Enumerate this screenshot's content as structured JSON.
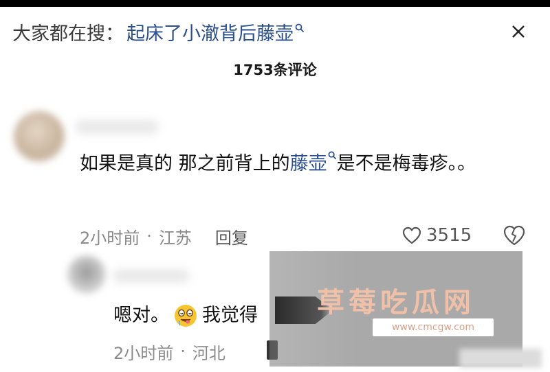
{
  "header": {
    "prefix": "大家都在搜：",
    "keyword": "起床了小澈背后藤壶",
    "search_icon": "search-icon",
    "close_icon": "close-icon"
  },
  "comments_count": "1753条评论",
  "comments": [
    {
      "text_before": "如果是真的 那之前背上的",
      "link_text": "藤壶",
      "text_after": "是不是梅毒疹。。",
      "time": "2小时前",
      "location": "江苏",
      "reply_label": "回复",
      "likes": "3515"
    },
    {
      "text_before": "嗯对。",
      "emoji": "drooling-face",
      "text_after": "我觉得",
      "time": "2小时前",
      "location": "河北"
    }
  ],
  "watermark": {
    "title": "草莓吃瓜网",
    "url": "www.cmcgw.com"
  },
  "colors": {
    "link": "#2b4f8c",
    "meta": "#8a8a8a",
    "watermark_text": "#f0c0a8"
  }
}
